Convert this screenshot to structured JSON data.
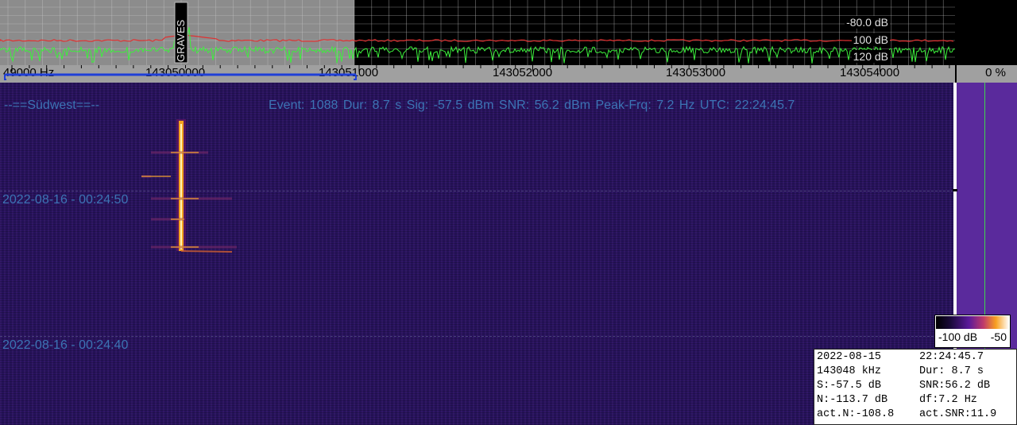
{
  "spectrum": {
    "db_labels": [
      "-80.0 dB",
      "100 dB",
      "120 dB"
    ],
    "vertical_marker_label": "GRAVES"
  },
  "freq_axis": {
    "labels": [
      "49000 Hz",
      "143050000",
      "143051000",
      "143052000",
      "143053000",
      "143054000"
    ],
    "percent": "0 %"
  },
  "waterfall": {
    "station": "--==Südwest==--",
    "event_info": "Event: 1088   Dur: 8.7 s   Sig: -57.5 dBm   SNR: 56.2 dBm   Peak-Frq: 7.2 Hz   UTC: 22:24:45.7",
    "timestamps": [
      "2022-08-16 - 00:24:50",
      "2022-08-16 - 00:24:40"
    ]
  },
  "colorscale": {
    "min_label": "-100 dB",
    "max_label": "-50"
  },
  "info_box": {
    "rows": [
      [
        "2022-08-15",
        "22:24:45.7"
      ],
      [
        "143048 kHz",
        "Dur: 8.7 s"
      ],
      [
        "S:-57.5 dB",
        "SNR:56.2 dB"
      ],
      [
        "N:-113.7 dB",
        "df:7.2 Hz"
      ],
      [
        "act.N:-108.8",
        "act.SNR:11.9"
      ]
    ]
  },
  "colors": {
    "spectrum_green": "#3cf03c",
    "spectrum_red": "#e03030",
    "waterfall_bg": "#26125a",
    "overlay_text": "#3c74b4",
    "selection_bar": "#1f3fd8"
  }
}
